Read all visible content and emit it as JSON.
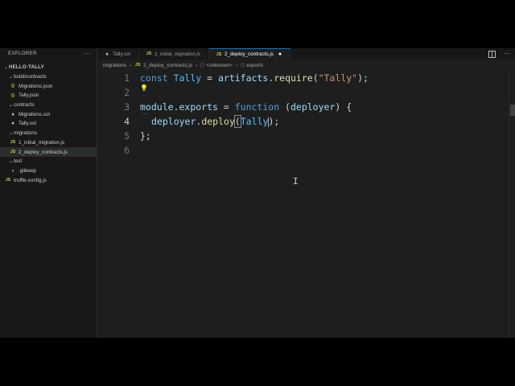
{
  "sidebar": {
    "title": "EXPLORER",
    "more": "···",
    "root": "HELLO-TALLY",
    "items": [
      {
        "label": "build/contracts",
        "type": "folder"
      },
      {
        "label": "Migrations.json",
        "type": "json",
        "icon": "{}"
      },
      {
        "label": "Tally.json",
        "type": "json",
        "icon": "{}"
      },
      {
        "label": "contracts",
        "type": "folder"
      },
      {
        "label": "Migrations.sol",
        "type": "sol",
        "icon": "♦"
      },
      {
        "label": "Tally.sol",
        "type": "sol",
        "icon": "♦"
      },
      {
        "label": "migrations",
        "type": "folder"
      },
      {
        "label": "1_initial_migration.js",
        "type": "js",
        "icon": "JS"
      },
      {
        "label": "2_deploy_contracts.js",
        "type": "js",
        "icon": "JS"
      },
      {
        "label": "test",
        "type": "folder"
      },
      {
        "label": ".gitkeep",
        "type": "git",
        "icon": "•"
      },
      {
        "label": "truffle-config.js",
        "type": "js",
        "icon": "JS"
      }
    ]
  },
  "tabs": [
    {
      "label": "Tally.sol",
      "icon": "♦"
    },
    {
      "label": "1_initial_migration.js",
      "icon": "JS"
    },
    {
      "label": "2_deploy_contracts.js",
      "icon": "JS",
      "dirty": "●"
    }
  ],
  "breadcrumb": {
    "folder": "migrations",
    "file_icon": "JS",
    "file": "2_deploy_contracts.js",
    "unknown_icon": "⬡",
    "unknown": "<unknown>",
    "symbol_icon": "⬡",
    "symbol": "exports",
    "separator": "›"
  },
  "editor": {
    "line_numbers": [
      "1",
      "2",
      "3",
      "4",
      "5",
      "6"
    ],
    "current_line": "4",
    "lines": {
      "l1": {
        "kw": "const",
        "var": "Tally",
        "eq": " = ",
        "obj": "artifacts",
        "dot": ".",
        "fn": "require",
        "open": "(",
        "str": "\"Tally\"",
        "close": ");"
      },
      "l3": {
        "obj": "module",
        "dot": ".",
        "prop": "exports",
        "eq": " = ",
        "kw": "function",
        "open": " (",
        "prm": "deployer",
        "close": ") {"
      },
      "l4": {
        "obj": "deployer",
        "dot": ".",
        "fn": "deploy",
        "open": "(",
        "arg": "Tally",
        "close": ");"
      },
      "l5": {
        "text": "};"
      }
    }
  },
  "colors": {
    "accent": "#0078d4",
    "keyword": "#569cd6",
    "string": "#ce9178",
    "function": "#dcdcaa",
    "variable": "#9cdcfe"
  }
}
